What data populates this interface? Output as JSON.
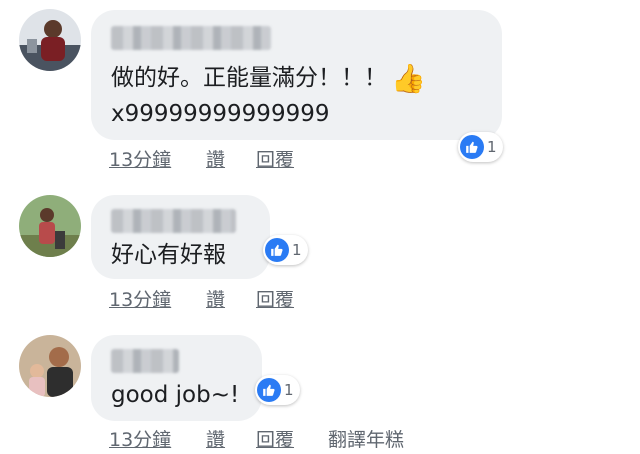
{
  "comments": [
    {
      "text_line1": "做的好。正能量滿分！！！",
      "thumb_emoji": "👍",
      "text_line2": "x99999999999999",
      "reactions": "1",
      "time": "13分鐘",
      "like": "讚",
      "reply": "回覆"
    },
    {
      "text": "好心有好報",
      "reactions": "1",
      "time": "13分鐘",
      "like": "讚",
      "reply": "回覆"
    },
    {
      "text": "good job~!",
      "reactions": "1",
      "time": "13分鐘",
      "like": "讚",
      "reply": "回覆",
      "translate": "翻譯年糕"
    }
  ],
  "colors": {
    "bubble": "#eff1f3",
    "like_blue": "#2a7bf4",
    "meta_gray": "#606770",
    "text": "#1c1e21"
  },
  "icons": [
    "avatar",
    "like-reaction-icon",
    "thumbs-up-emoji"
  ]
}
